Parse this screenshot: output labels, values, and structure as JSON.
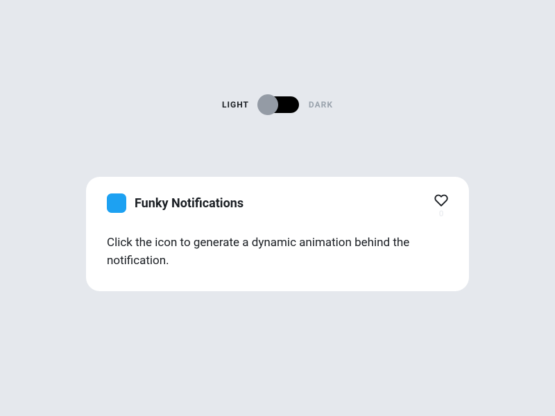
{
  "theme_toggle": {
    "light_label": "LIGHT",
    "dark_label": "DARK",
    "state": "light"
  },
  "notification": {
    "title": "Funky Notifications",
    "body": "Click the icon to generate a dynamic animation behind the notification.",
    "like_count": "0",
    "icon_color": "#1da1f2"
  },
  "colors": {
    "background": "#e5e8ed",
    "card": "#ffffff",
    "text_primary": "#1a1e23",
    "text_muted": "#9aa3ad",
    "toggle_track": "#000000",
    "toggle_knob": "#949ba5"
  }
}
